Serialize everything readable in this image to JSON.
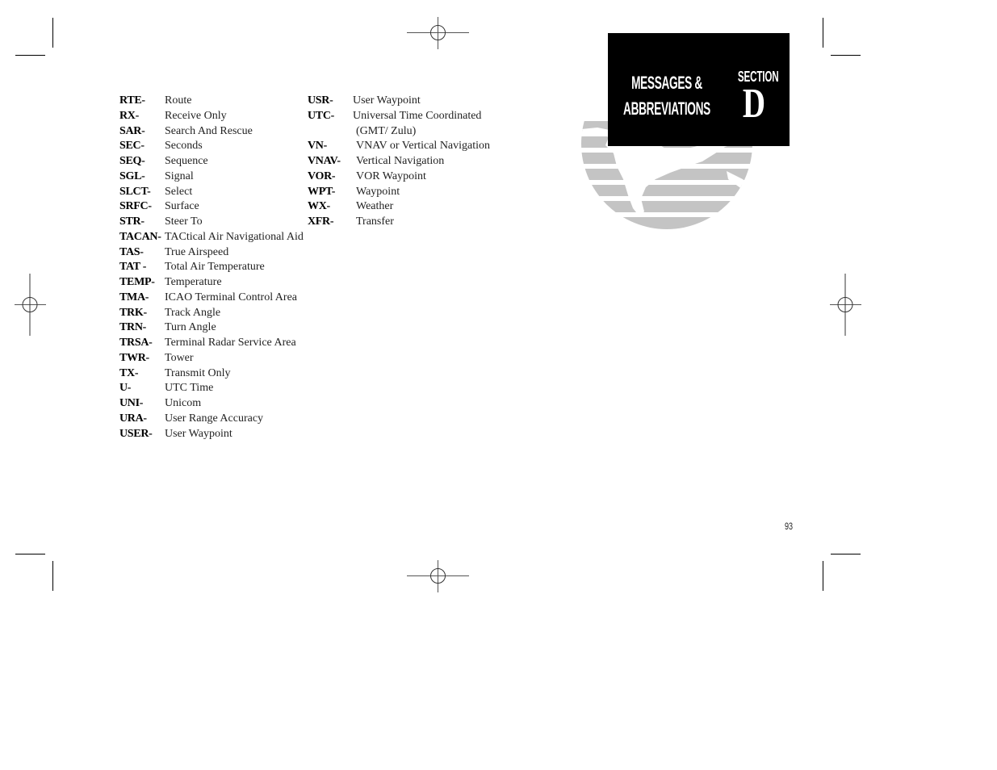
{
  "header": {
    "title_line1": "MESSAGES &",
    "title_line2": "ABBREVIATIONS",
    "section_label": "SECTION",
    "section_letter": "D"
  },
  "page_number": "93",
  "abbreviations": {
    "column1": [
      {
        "abbr": "RTE-",
        "definition": "Route"
      },
      {
        "abbr": "RX-",
        "definition": "Receive Only"
      },
      {
        "abbr": "SAR-",
        "definition": "Search And Rescue"
      },
      {
        "abbr": "SEC-",
        "definition": "Seconds"
      },
      {
        "abbr": "SEQ-",
        "definition": "Sequence"
      },
      {
        "abbr": "SGL-",
        "definition": "Signal"
      },
      {
        "abbr": "SLCT-",
        "definition": "Select"
      },
      {
        "abbr": "SRFC-",
        "definition": "Surface"
      },
      {
        "abbr": "STR-",
        "definition": "Steer To"
      },
      {
        "abbr": "TACAN-",
        "definition": "TACtical Air Navigational Aid"
      },
      {
        "abbr": "TAS-",
        "definition": "True Airspeed"
      },
      {
        "abbr": "TAT -",
        "definition": "Total Air Temperature"
      },
      {
        "abbr": "TEMP-",
        "definition": "Temperature"
      },
      {
        "abbr": "TMA-",
        "definition": "ICAO Terminal Control Area"
      },
      {
        "abbr": "TRK-",
        "definition": "Track Angle"
      },
      {
        "abbr": "TRN-",
        "definition": "Turn Angle"
      },
      {
        "abbr": "TRSA-",
        "definition": "Terminal Radar Service Area"
      },
      {
        "abbr": "TWR-",
        "definition": "Tower"
      },
      {
        "abbr": "TX-",
        "definition": "Transmit Only"
      },
      {
        "abbr": "U-",
        "definition": "UTC Time"
      },
      {
        "abbr": "UNI-",
        "definition": "Unicom"
      },
      {
        "abbr": "URA-",
        "definition": "User Range Accuracy"
      },
      {
        "abbr": "USER-",
        "definition": "User Waypoint"
      }
    ],
    "column2": [
      {
        "abbr": "USR-",
        "definition": "User Waypoint"
      },
      {
        "abbr": "UTC-",
        "definition": "Universal Time Coordinated",
        "definition_line2": "(GMT/ Zulu)"
      },
      {
        "abbr": "VN-",
        "definition": "VNAV or Vertical Navigation"
      },
      {
        "abbr": "VNAV-",
        "definition": "Vertical Navigation"
      },
      {
        "abbr": "VOR-",
        "definition": "VOR Waypoint"
      },
      {
        "abbr": "WPT-",
        "definition": "Waypoint"
      },
      {
        "abbr": "WX-",
        "definition": "Weather"
      },
      {
        "abbr": "XFR-",
        "definition": "Transfer"
      }
    ]
  },
  "colors": {
    "header_background": "#000000",
    "header_text": "#ffffff",
    "globe_gray": "#c4c4c4"
  }
}
